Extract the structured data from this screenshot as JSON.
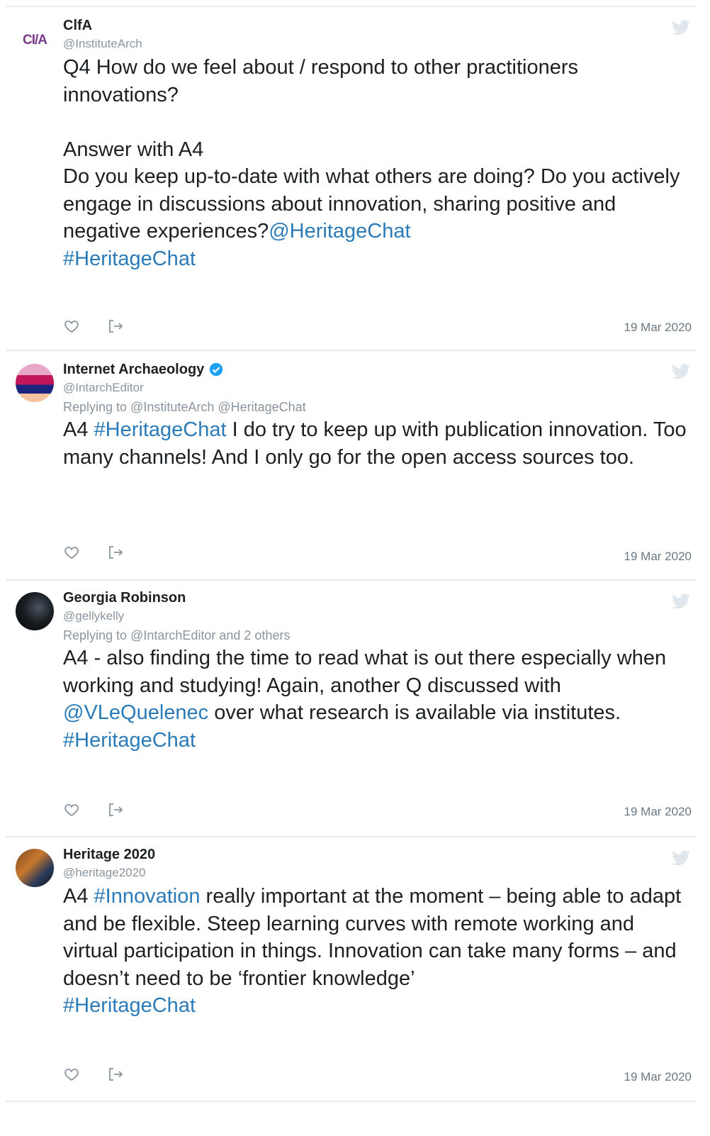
{
  "tweets": [
    {
      "name": "ClfA",
      "handle": "@InstituteArch",
      "avatar_text": "CI/A",
      "avatar_color": "#7a3b8c",
      "verified": false,
      "replying": "",
      "text_parts": [
        {
          "t": "Q4 How do we feel about / respond to other practitioners innovations?\n\nAnswer with A4\nDo you keep up-to-date with what others are doing? Do you actively engage in discussions about innovation, sharing positive and negative experiences?",
          "link": false
        },
        {
          "t": "@HeritageChat",
          "link": true
        },
        {
          "t": "\n",
          "link": false
        },
        {
          "t": "#HeritageChat",
          "link": true
        }
      ],
      "date": "19 Mar 2020"
    },
    {
      "name": "Internet Archaeology",
      "handle": "@IntarchEditor",
      "verified": true,
      "replying": "Replying to @InstituteArch @HeritageChat",
      "text_parts": [
        {
          "t": "A4 ",
          "link": false
        },
        {
          "t": "#HeritageChat",
          "link": true
        },
        {
          "t": " I do try to keep up with publication innovation. Too many channels! And I only go for the open access sources too.",
          "link": false
        }
      ],
      "date": "19 Mar 2020"
    },
    {
      "name": "Georgia Robinson",
      "handle": "@gellykelly",
      "verified": false,
      "replying": "Replying to @IntarchEditor and 2 others",
      "text_parts": [
        {
          "t": "A4 - also finding the time to read what is out there especially when working and studying! Again, another Q discussed with ",
          "link": false
        },
        {
          "t": "@VLeQuelenec",
          "link": true
        },
        {
          "t": " over what research is available via institutes.\n",
          "link": false
        },
        {
          "t": "#HeritageChat",
          "link": true
        }
      ],
      "date": "19 Mar 2020"
    },
    {
      "name": "Heritage 2020",
      "handle": "@heritage2020",
      "verified": false,
      "replying": "",
      "text_parts": [
        {
          "t": "A4 ",
          "link": false
        },
        {
          "t": "#Innovation",
          "link": true
        },
        {
          "t": " really important at the moment – being able to adapt and be flexible. Steep learning curves with remote working and virtual participation in things. Innovation can take many forms – and doesn’t need to be ‘frontier knowledge’\n",
          "link": false
        },
        {
          "t": "#HeritageChat",
          "link": true
        }
      ],
      "date": "19 Mar 2020"
    }
  ],
  "colors": {
    "link": "#2b7bb9",
    "muted": "#8a959f",
    "divider": "#e6ecf0",
    "verified": "#1da1f2"
  },
  "icons": {
    "like": "heart-icon",
    "share": "share-icon",
    "brand": "twitter-bird-icon",
    "verified": "verified-badge-icon"
  }
}
